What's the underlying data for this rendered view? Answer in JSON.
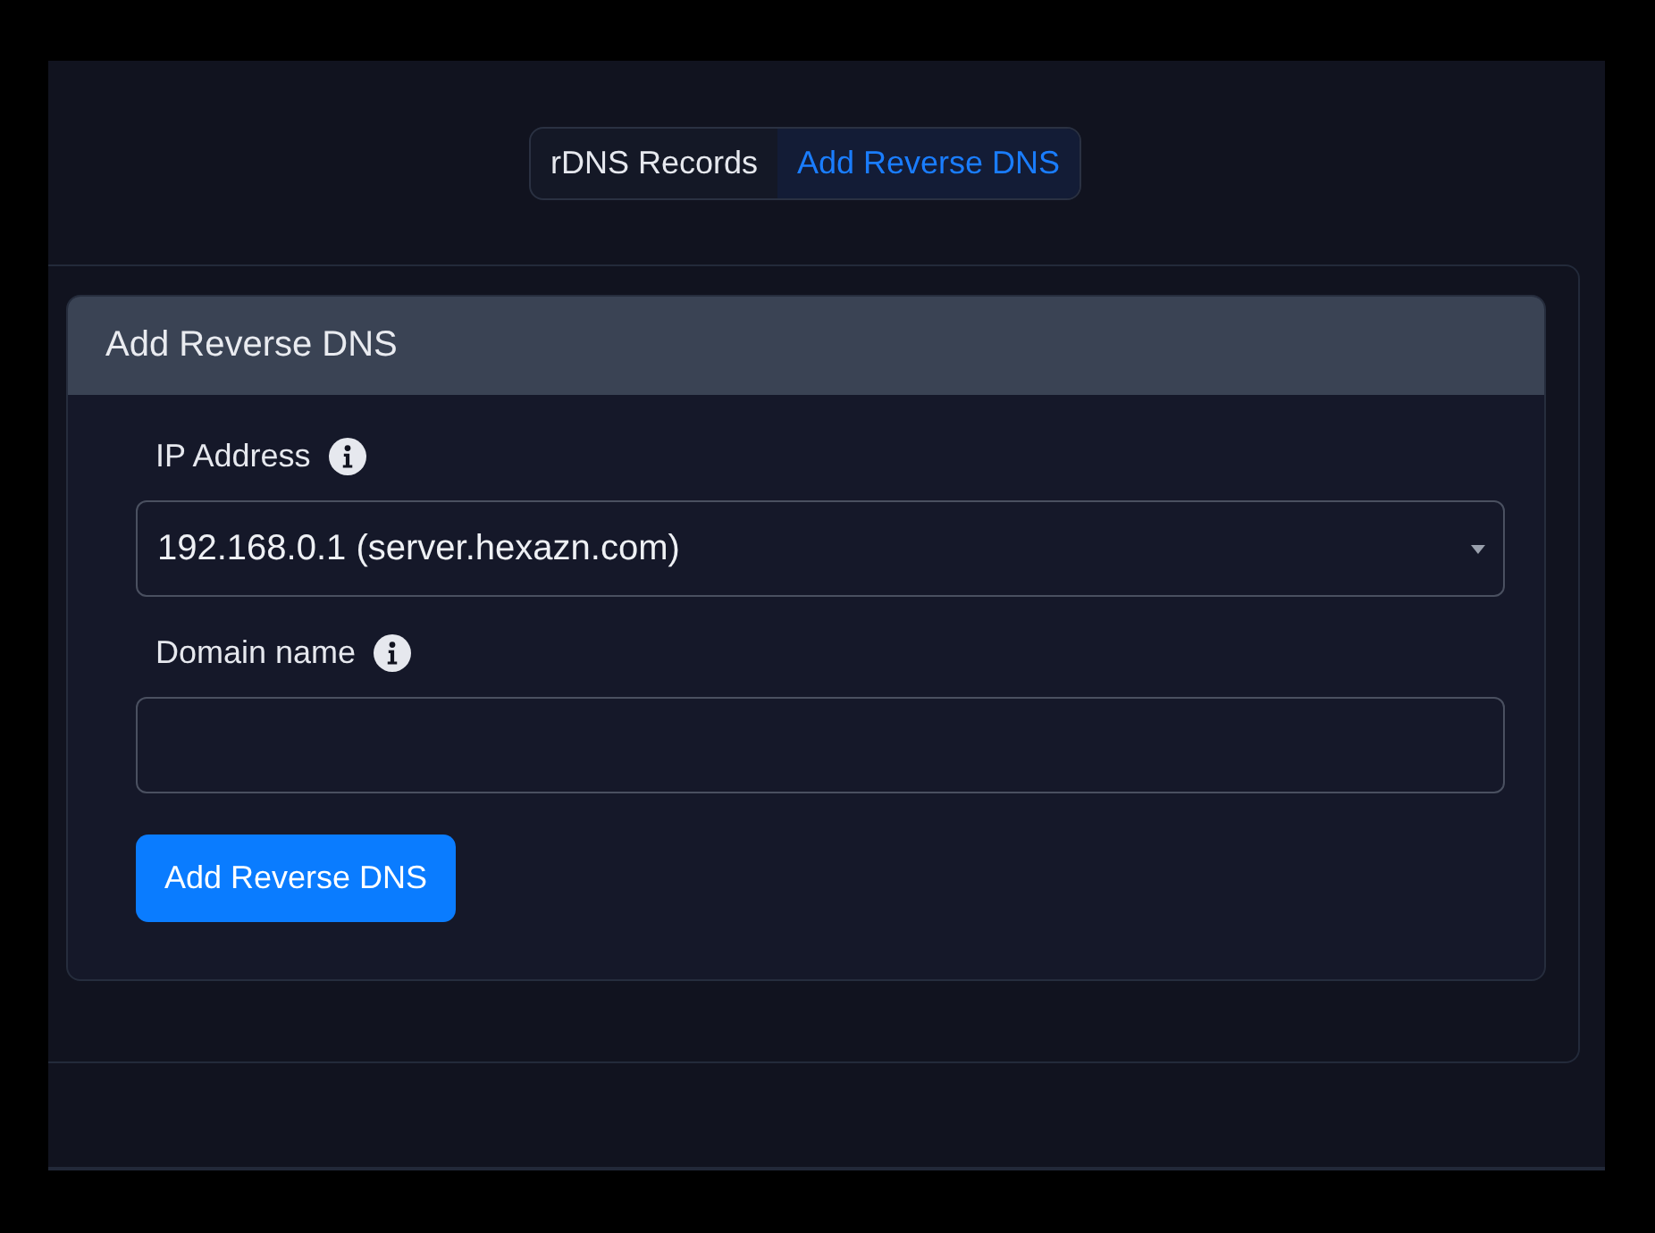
{
  "tabs": [
    {
      "label": "rDNS Records",
      "selected": false
    },
    {
      "label": "Add Reverse DNS",
      "selected": true
    }
  ],
  "card": {
    "title": "Add Reverse DNS",
    "fields": [
      {
        "kind": "select",
        "label": "IP Address",
        "value": "192.168.0.1 (server.hexazn.com)"
      },
      {
        "kind": "text",
        "label": "Domain name"
      }
    ],
    "submit": "Add Reverse DNS"
  }
}
